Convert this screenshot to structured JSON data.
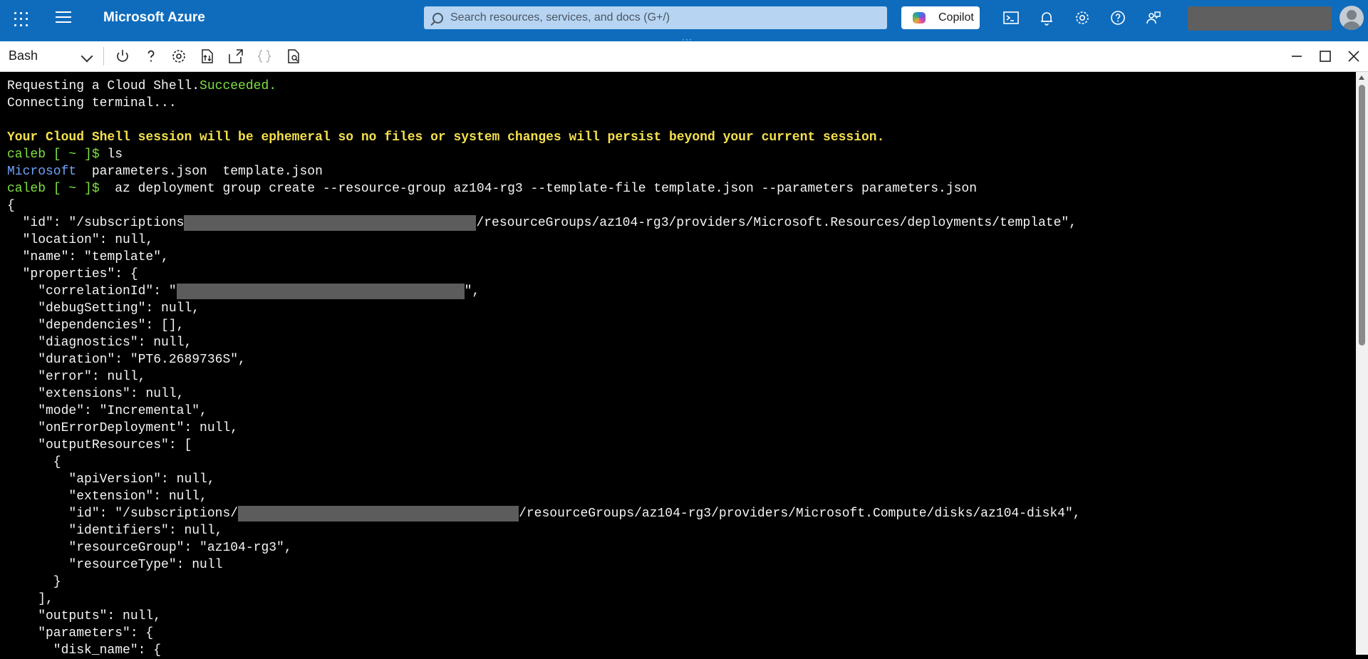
{
  "topbar": {
    "brand": "Microsoft Azure",
    "search_placeholder": "Search resources, services, and docs (G+/)",
    "copilot_label": "Copilot",
    "icons": [
      "cloud-shell-icon",
      "notifications-icon",
      "settings-icon",
      "help-icon",
      "feedback-icon"
    ]
  },
  "toolbar": {
    "shell": "Bash",
    "icons": [
      "restart-icon",
      "help-icon",
      "settings-icon",
      "upload-download-icon",
      "open-new-session-icon",
      "editor-braces-icon",
      "web-preview-icon"
    ],
    "window_controls": [
      "minimize-icon",
      "maximize-icon",
      "close-icon"
    ]
  },
  "terminal": {
    "l1a": "Requesting a Cloud Shell.",
    "l1b": "Succeeded.",
    "l2": "Connecting terminal...",
    "l3": "Your Cloud Shell session will be ephemeral so no files or system changes will persist beyond your current session.",
    "prompt": "caleb [ ~ ]$",
    "cmd1": " ls",
    "ls_dir": "Microsoft",
    "ls_files": "  parameters.json  template.json",
    "cmd2": "  az deployment group create --resource-group az104-rg3 --template-file template.json --parameters parameters.json",
    "j1": "{",
    "j2a": "  \"id\": \"/subscriptions",
    "j2b": "/resourceGroups/az104-rg3/providers/Microsoft.Resources/deployments/template\",",
    "j3": "  \"location\": null,",
    "j4": "  \"name\": \"template\",",
    "j5": "  \"properties\": {",
    "j6a": "    \"correlationId\": \"",
    "j6b": "\",",
    "j7": "    \"debugSetting\": null,",
    "j8": "    \"dependencies\": [],",
    "j9": "    \"diagnostics\": null,",
    "j10": "    \"duration\": \"PT6.2689736S\",",
    "j11": "    \"error\": null,",
    "j12": "    \"extensions\": null,",
    "j13": "    \"mode\": \"Incremental\",",
    "j14": "    \"onErrorDeployment\": null,",
    "j15": "    \"outputResources\": [",
    "j16": "      {",
    "j17": "        \"apiVersion\": null,",
    "j18": "        \"extension\": null,",
    "j19a": "        \"id\": \"/subscriptions/",
    "j19b": "/resourceGroups/az104-rg3/providers/Microsoft.Compute/disks/az104-disk4\",",
    "j20": "        \"identifiers\": null,",
    "j21": "        \"resourceGroup\": \"az104-rg3\",",
    "j22": "        \"resourceType\": null",
    "j23": "      }",
    "j24": "    ],",
    "j25": "    \"outputs\": null,",
    "j26": "    \"parameters\": {",
    "j27": "      \"disk_name\": {"
  }
}
